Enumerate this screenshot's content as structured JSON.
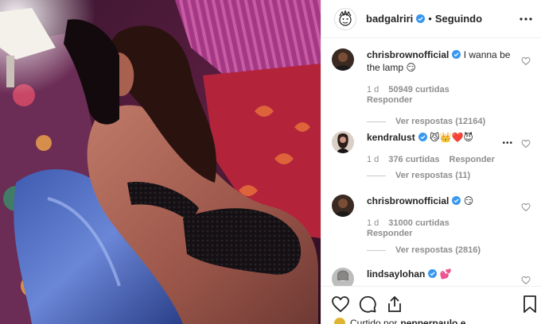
{
  "post": {
    "username": "badgalriri",
    "separator": "•",
    "follow_state": "Seguindo",
    "verified_color": "#3897f0"
  },
  "comments": [
    {
      "username": "chrisbrownofficial",
      "text": "I wanna be the lamp 😏",
      "time": "1 d",
      "likes": "50949 curtidas",
      "reply": "Responder",
      "replies": "Ver respostas (12164)"
    },
    {
      "username": "kendralust",
      "text": "😼👑❤️😈",
      "time": "1 d",
      "likes": "376 curtidas",
      "reply": "Responder",
      "more": "•••",
      "replies": "Ver respostas (11)"
    },
    {
      "username": "chrisbrownofficial",
      "text": "😏",
      "time": "1 d",
      "likes": "31000 curtidas",
      "reply": "Responder",
      "replies": "Ver respostas (2816)"
    },
    {
      "username": "lindsaylohan",
      "text": "💕"
    }
  ],
  "actions": {
    "icons": [
      "heart-icon",
      "comment-icon",
      "share-icon",
      "bookmark-icon"
    ]
  },
  "liked_by": {
    "prefix": "Curtido por",
    "user": "pepperpaulo e"
  }
}
